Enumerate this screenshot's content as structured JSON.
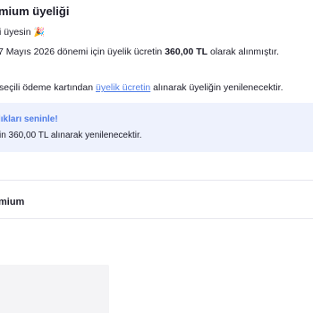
{
  "header": {
    "title": "mium üyeliği"
  },
  "membership": {
    "status_text": "i üyesin",
    "status_emoji": "🎉",
    "charged_prefix": "7 Mayıs 2026 dönemi için üyelik ücretin ",
    "charged_amount": "360,00 TL",
    "charged_suffix": " olarak alınmıştır.",
    "renew_prefix": " seçili ödeme kartından ",
    "renew_link": "üyelik ücretin",
    "renew_suffix": " alınarak üyeliğin yenilenecektir."
  },
  "banner": {
    "title": "lıkları seninle!",
    "text": "in 360,00 TL alınarak yenilenecektir."
  },
  "plan": {
    "label": "mium"
  },
  "colors": {
    "accent": "#4f7de8",
    "banner_bg": "#eef2fd",
    "divider": "#e7e7ee"
  }
}
